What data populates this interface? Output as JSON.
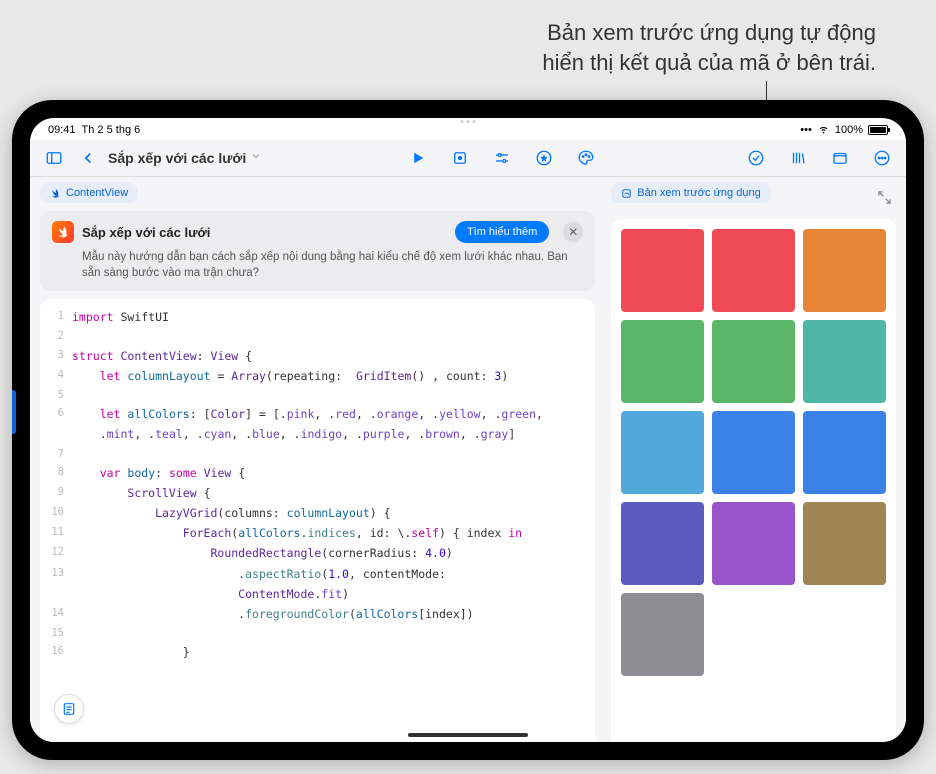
{
  "annotation": {
    "line1": "Bản xem trước ứng dụng tự động",
    "line2": "hiển thị kết quả của mã ở bên trái."
  },
  "status": {
    "time": "09:41",
    "date": "Th 2 5 thg 6",
    "signal": "•••",
    "wifi_icon": "wifi",
    "battery_pct": "100%"
  },
  "toolbar": {
    "title": "Sắp xếp với các lưới"
  },
  "editor": {
    "file_pill": "ContentView",
    "info_title": "Sắp xếp với các lưới",
    "learn_more": "Tìm hiểu thêm",
    "info_desc": "Mẫu này hướng dẫn bạn cách sắp xếp nội dung bằng hai kiểu chế độ xem lưới khác nhau. Bạn sẵn sàng bước vào ma trận chưa?"
  },
  "code_lines": [
    {
      "n": "1",
      "html": "<span class='kw'>import</span> SwiftUI"
    },
    {
      "n": "2",
      "html": ""
    },
    {
      "n": "3",
      "html": "<span class='kw'>struct</span> <span class='ty'>ContentView</span>: <span class='ty'>View</span> {"
    },
    {
      "n": "4",
      "html": "    <span class='kw'>let</span> <span class='name'>columnLayout</span> = <span class='ty'>Array</span>(repeating:  <span class='ty'>GridItem</span>() , count: <span class='num'>3</span>)"
    },
    {
      "n": "5",
      "html": ""
    },
    {
      "n": "6",
      "html": "    <span class='kw'>let</span> <span class='name'>allColors</span>: [<span class='ty'>Color</span>] = [.<span class='dot'>pink</span>, .<span class='dot'>red</span>, .<span class='dot'>orange</span>, .<span class='dot'>yellow</span>, .<span class='dot'>green</span>,"
    },
    {
      "n": "",
      "html": "    .<span class='dot'>mint</span>, .<span class='dot'>teal</span>, .<span class='dot'>cyan</span>, .<span class='dot'>blue</span>, .<span class='dot'>indigo</span>, .<span class='dot'>purple</span>, .<span class='dot'>brown</span>, .<span class='dot'>gray</span>]"
    },
    {
      "n": "7",
      "html": ""
    },
    {
      "n": "8",
      "html": "    <span class='kw'>var</span> <span class='name'>body</span>: <span class='kw'>some</span> <span class='ty'>View</span> {"
    },
    {
      "n": "9",
      "html": "        <span class='ty'>ScrollView</span> {"
    },
    {
      "n": "10",
      "html": "            <span class='ty'>LazyVGrid</span>(columns: <span class='name'>columnLayout</span>) {"
    },
    {
      "n": "11",
      "html": "                <span class='ty'>ForEach</span>(<span class='name'>allColors</span>.<span class='fn'>indices</span>, id: \\.<span class='kw'>self</span>) { index <span class='kw'>in</span>"
    },
    {
      "n": "12",
      "html": "                    <span class='ty'>RoundedRectangle</span>(cornerRadius: <span class='num'>4.0</span>)"
    },
    {
      "n": "13",
      "html": "                        .<span class='fn'>aspectRatio</span>(<span class='num'>1.0</span>, contentMode:"
    },
    {
      "n": "",
      "html": "                        <span class='ty'>ContentMode</span>.<span class='dot'>fit</span>)"
    },
    {
      "n": "14",
      "html": "                        .<span class='fn'>foregroundColor</span>(<span class='name'>allColors</span>[index])"
    },
    {
      "n": "15",
      "html": ""
    },
    {
      "n": "16",
      "html": "                }"
    }
  ],
  "preview": {
    "pill_label": "Bản xem trước ứng dụng",
    "colors": [
      "#ef4a55",
      "#ef4a55",
      "#e88436",
      "#5ab769",
      "#5ab769",
      "#4fb6a6",
      "#52a8db",
      "#3b82e6",
      "#3b82e6",
      "#5c5bc0",
      "#9a54c9",
      "#a08454",
      "#8e8e93"
    ]
  }
}
